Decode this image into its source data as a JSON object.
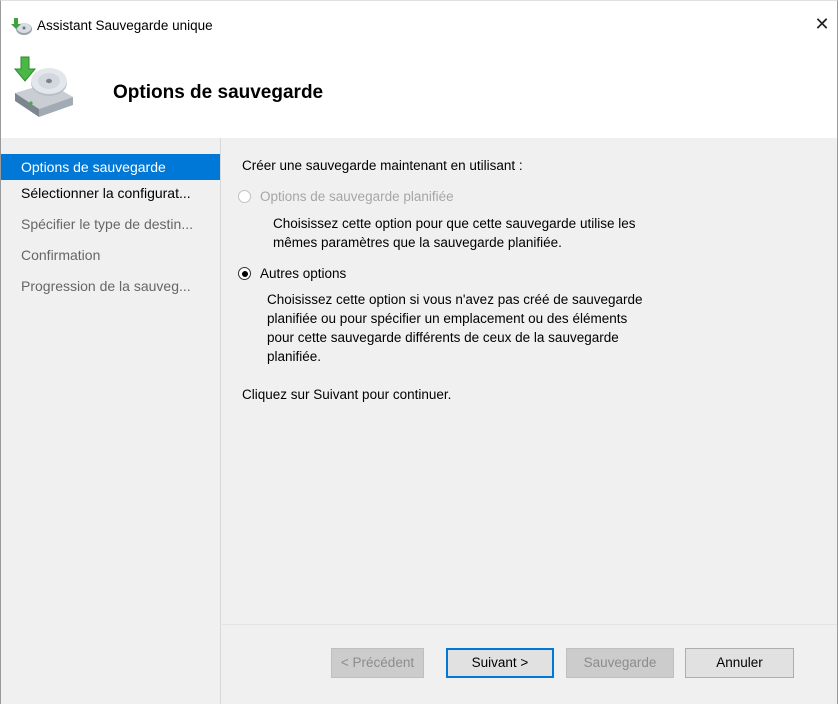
{
  "window": {
    "title": "Assistant Sauvegarde unique",
    "close_glyph": "✕"
  },
  "header": {
    "title": "Options de sauvegarde",
    "icon": "backup-disk-icon"
  },
  "sidebar": {
    "items": [
      {
        "label": "Options de sauvegarde"
      },
      {
        "label": "Sélectionner la configurat..."
      },
      {
        "label": "Spécifier le type de destin..."
      },
      {
        "label": "Confirmation"
      },
      {
        "label": "Progression de la sauveg..."
      }
    ]
  },
  "main": {
    "intro": "Créer une sauvegarde maintenant en utilisant :",
    "option_scheduled": {
      "label": "Options de sauvegarde planifiée",
      "desc_line1": "Choisissez cette option pour que cette sauvegarde utilise les",
      "desc_line2": "mêmes paramètres que la sauvegarde planifiée."
    },
    "option_other": {
      "label": "Autres options",
      "desc_line1": "Choisissez cette option si vous n'avez pas créé de sauvegarde",
      "desc_line2": "planifiée ou pour spécifier un emplacement ou des éléments",
      "desc_line3": "pour cette sauvegarde différents de ceux de la sauvegarde",
      "desc_line4": "planifiée."
    },
    "continue_hint": "Cliquez sur Suivant pour continuer."
  },
  "footer": {
    "prev_label": "< Précédent",
    "next_label": "Suivant >",
    "backup_label": "Sauvegarde",
    "cancel_label": "Annuler"
  },
  "colors": {
    "accent": "#0078d7",
    "panel_bg": "#f0f0f0"
  }
}
